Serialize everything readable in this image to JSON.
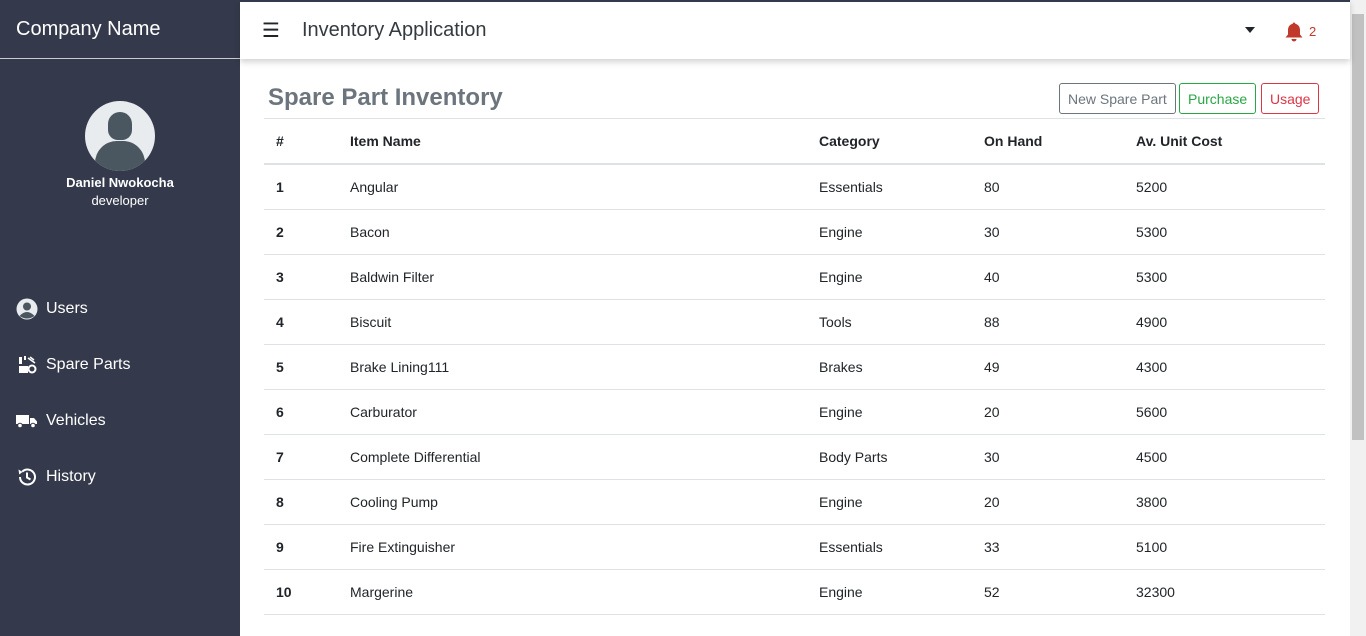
{
  "sidebar": {
    "brand": "Company Name",
    "user": {
      "name": "Daniel Nwokocha",
      "role": "developer"
    },
    "items": [
      {
        "label": "Users",
        "icon": "user-circle-icon"
      },
      {
        "label": "Spare Parts",
        "icon": "spare-parts-icon"
      },
      {
        "label": "Vehicles",
        "icon": "truck-icon"
      },
      {
        "label": "History",
        "icon": "history-icon"
      }
    ]
  },
  "topbar": {
    "title": "Inventory Application",
    "notifications": "2"
  },
  "main": {
    "title": "Spare Part Inventory",
    "buttons": {
      "new": "New Spare Part",
      "purchase": "Purchase",
      "usage": "Usage"
    },
    "columns": [
      "#",
      "Item Name",
      "Category",
      "On Hand",
      "Av. Unit Cost"
    ],
    "rows": [
      [
        "1",
        "Angular",
        "Essentials",
        "80",
        "5200"
      ],
      [
        "2",
        "Bacon",
        "Engine",
        "30",
        "5300"
      ],
      [
        "3",
        "Baldwin Filter",
        "Engine",
        "40",
        "5300"
      ],
      [
        "4",
        "Biscuit",
        "Tools",
        "88",
        "4900"
      ],
      [
        "5",
        "Brake Lining111",
        "Brakes",
        "49",
        "4300"
      ],
      [
        "6",
        "Carburator",
        "Engine",
        "20",
        "5600"
      ],
      [
        "7",
        "Complete Differential",
        "Body Parts",
        "30",
        "4500"
      ],
      [
        "8",
        "Cooling Pump",
        "Engine",
        "20",
        "3800"
      ],
      [
        "9",
        "Fire Extinguisher",
        "Essentials",
        "33",
        "5100"
      ],
      [
        "10",
        "Margerine",
        "Engine",
        "52",
        "32300"
      ]
    ]
  },
  "colors": {
    "sidebar": "#343a4b",
    "secondary": "#6c757d",
    "success": "#28a745",
    "danger": "#dc3545",
    "bell": "#c0392b"
  }
}
